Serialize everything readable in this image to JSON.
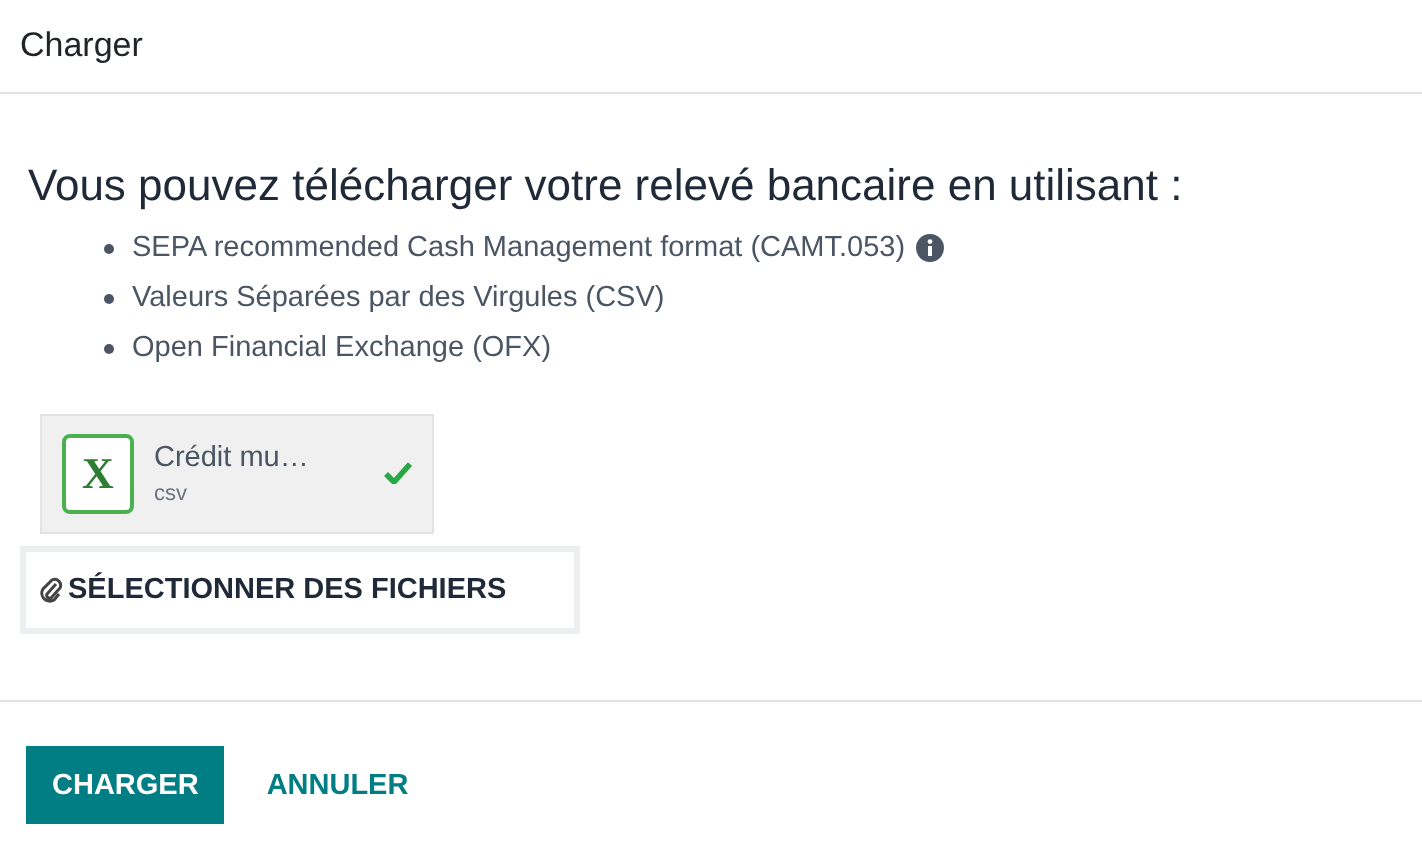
{
  "window": {
    "title": "Charger"
  },
  "heading": "Vous pouvez télécharger votre relevé bancaire en utilisant :",
  "formats": [
    {
      "label": "SEPA recommended Cash Management format (CAMT.053)",
      "info": true
    },
    {
      "label": "Valeurs Séparées par des Virgules (CSV)",
      "info": false
    },
    {
      "label": "Open Financial Exchange (OFX)",
      "info": false
    }
  ],
  "attachment": {
    "icon_letter": "X",
    "name": "Crédit mu…",
    "extension": "csv",
    "uploaded": true
  },
  "select_button": "SÉLECTIONNER DES FICHIERS",
  "buttons": [
    {
      "label": "CHARGER",
      "kind": "primary"
    },
    {
      "label": "ANNULER",
      "kind": "link"
    }
  ]
}
